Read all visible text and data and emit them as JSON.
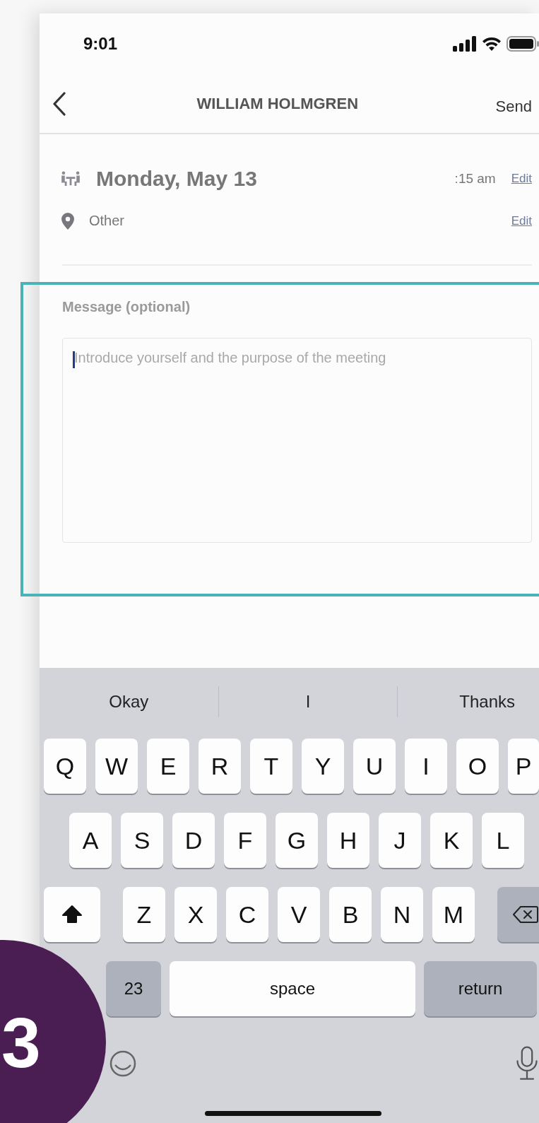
{
  "status_bar": {
    "time": "9:01"
  },
  "nav": {
    "title": "WILLIAM HOLMGREN",
    "action": "Send"
  },
  "details": [
    {
      "kind": "date",
      "text": "Monday, May 13",
      "time": ":15 am",
      "link": "Edit"
    },
    {
      "kind": "location",
      "text": "Other",
      "link": "Edit"
    }
  ],
  "message": {
    "label": "Message (optional)",
    "placeholder": "Introduce yourself and the purpose of the meeting",
    "focused": true,
    "highlighted": true
  },
  "keyboard": {
    "suggestions": [
      "Okay",
      "I",
      "Thanks"
    ],
    "rows": [
      [
        {
          "kind": "letter",
          "label": "Q"
        },
        {
          "kind": "letter",
          "label": "W"
        },
        {
          "kind": "letter",
          "label": "E"
        },
        {
          "kind": "letter",
          "label": "R"
        },
        {
          "kind": "letter",
          "label": "T"
        },
        {
          "kind": "letter",
          "label": "Y"
        },
        {
          "kind": "letter",
          "label": "U"
        },
        {
          "kind": "letter",
          "label": "I"
        },
        {
          "kind": "letter",
          "label": "O"
        },
        {
          "kind": "letter",
          "label": "P"
        }
      ],
      [
        {
          "kind": "letter",
          "label": "A"
        },
        {
          "kind": "letter",
          "label": "S"
        },
        {
          "kind": "letter",
          "label": "D"
        },
        {
          "kind": "letter",
          "label": "F"
        },
        {
          "kind": "letter",
          "label": "G"
        },
        {
          "kind": "letter",
          "label": "H"
        },
        {
          "kind": "letter",
          "label": "J"
        },
        {
          "kind": "letter",
          "label": "K"
        },
        {
          "kind": "letter",
          "label": "L"
        }
      ],
      [
        {
          "kind": "shift",
          "on": true
        },
        {
          "kind": "letter",
          "label": "Z"
        },
        {
          "kind": "letter",
          "label": "X"
        },
        {
          "kind": "letter",
          "label": "C"
        },
        {
          "kind": "letter",
          "label": "V"
        },
        {
          "kind": "letter",
          "label": "B"
        },
        {
          "kind": "letter",
          "label": "N"
        },
        {
          "kind": "letter",
          "label": "M"
        },
        {
          "kind": "delete"
        }
      ]
    ],
    "bottom_keys": {
      "numbers": "23",
      "space": "space",
      "return": "return"
    }
  },
  "step_badge": "3"
}
